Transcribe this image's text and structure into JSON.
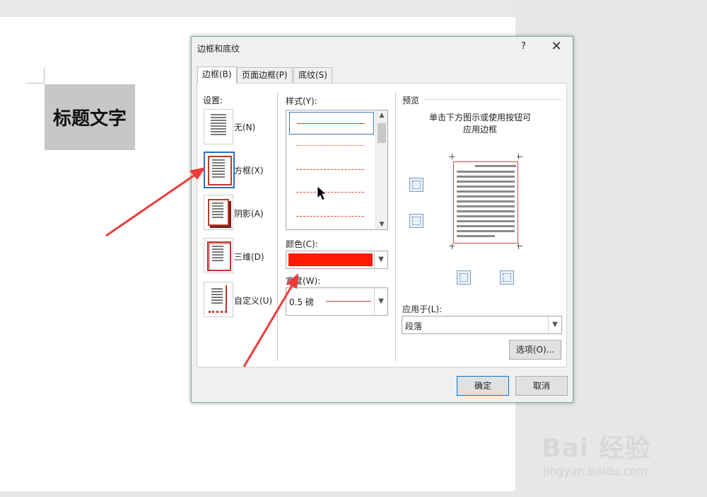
{
  "document": {
    "heading_text": "标题文字"
  },
  "dialog": {
    "title": "边框和底纹",
    "help_label": "?",
    "close_label": "✕",
    "tabs": [
      {
        "label": "边框(B)"
      },
      {
        "label": "页面边框(P)"
      },
      {
        "label": "底纹(S)"
      }
    ],
    "setting": {
      "label": "设置:",
      "options": [
        {
          "label": "无(N)"
        },
        {
          "label": "方框(X)"
        },
        {
          "label": "阴影(A)"
        },
        {
          "label": "三维(D)"
        },
        {
          "label": "自定义(U)"
        }
      ]
    },
    "style_label": "样式(Y):",
    "color_label": "颜色(C):",
    "color_value": "#ff1a00",
    "width_label": "宽度(W):",
    "width_value": "0.5 磅",
    "preview": {
      "title": "预览",
      "hint_line1": "单击下方图示或使用按钮可",
      "hint_line2": "应用边框"
    },
    "apply_to_label": "应用于(L):",
    "apply_to_value": "段落",
    "options_button": "选项(O)...",
    "ok_button": "确定",
    "cancel_button": "取消"
  },
  "watermark": {
    "brand": "Bai 经验",
    "url": "jingyan.baidu.com"
  },
  "colors": {
    "accent_blue": "#2b6dcc",
    "border_red": "#d04a3a",
    "annotation_red": "#ef3b3b"
  }
}
